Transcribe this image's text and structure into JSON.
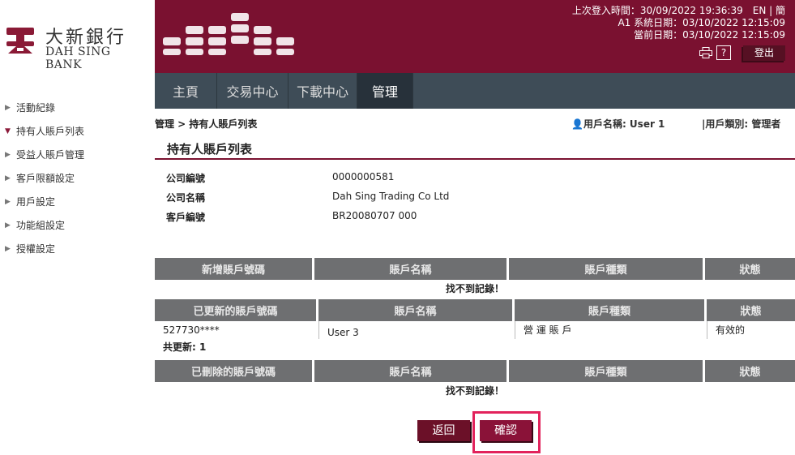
{
  "logo": {
    "cn": "大新銀行",
    "en": "DAH SING BANK"
  },
  "header": {
    "last_login_label": "上次登入時間：",
    "last_login": "30/09/2022 19:36:39",
    "lang_en": "EN",
    "lang_sc": "簡",
    "system_date_label": "A1 系統日期：",
    "system_date": "03/10/2022 12:15:09",
    "current_date_label": "當前日期：",
    "current_date": "03/10/2022 12:15:09",
    "help": "?",
    "logout": "登出"
  },
  "nav": {
    "items": [
      "主頁",
      "交易中心",
      "下載中心",
      "管理"
    ],
    "active": "管理"
  },
  "sidebar": {
    "items": [
      {
        "label": "活動紀錄"
      },
      {
        "label": "持有人賬戶列表",
        "active": true
      },
      {
        "label": "受益人賬戶管理"
      },
      {
        "label": "客戶限額設定"
      },
      {
        "label": "用戶設定"
      },
      {
        "label": "功能組設定"
      },
      {
        "label": "授權設定"
      }
    ]
  },
  "breadcrumb": "管理 > 持有人賬戶列表",
  "user": {
    "name": "用戶名稱: User 1",
    "type": "|用戶類別: 管理者"
  },
  "page_title": "持有人賬戶列表",
  "details": [
    {
      "label": "公司編號",
      "value": "0000000581"
    },
    {
      "label": "公司名稱",
      "value": "Dah Sing Trading Co Ltd"
    },
    {
      "label": "客戶編號",
      "value": "BR20080707 000"
    }
  ],
  "tables": {
    "new": {
      "headers": [
        "新增賬戶號碼",
        "賬戶名稱",
        "賬戶種類",
        "狀態"
      ],
      "empty": "找不到記錄！"
    },
    "updated": {
      "headers": [
        "已更新的賬戶號碼",
        "賬戶名稱",
        "賬戶種類",
        "狀態"
      ],
      "rows": [
        [
          "527730****",
          "User 3",
          "營 運 賬 戶",
          "有效的"
        ]
      ],
      "total": "共更新: 1"
    },
    "deleted": {
      "headers": [
        "已刪除的賬戶號碼",
        "賬戶名稱",
        "賬戶種類",
        "狀態"
      ],
      "empty": "找不到記錄！"
    }
  },
  "buttons": {
    "back": "返回",
    "confirm": "確認"
  },
  "colors": {
    "brand": "#7a1130",
    "nav": "#3e4c57",
    "table_header": "#6e6f71",
    "highlight": "#e2235c"
  }
}
